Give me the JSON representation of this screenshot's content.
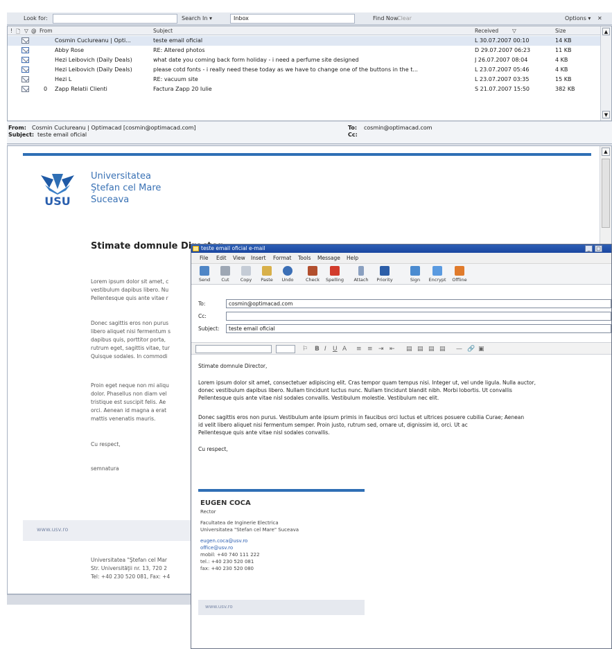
{
  "findbar": {
    "look_for_label": "Look for:",
    "search_in_label": "Search In ▾",
    "search_in_value": "Inbox",
    "find_now": "Find Now",
    "clear": "Clear",
    "options": "Options ▾",
    "close": "✕"
  },
  "list": {
    "headers": {
      "importance": "!",
      "icon": "🗋",
      "flag": "▽",
      "attach": "@",
      "from": "From",
      "subject": "Subject",
      "received": "Received",
      "sort": "▽",
      "size": "Size"
    },
    "rows": [
      {
        "from": "Cosmin Cuclureanu | Opti...",
        "subject": "teste email oficial",
        "received": "L 30.07.2007 00:10",
        "size": "14 KB",
        "attach": ""
      },
      {
        "from": "Abby Rose",
        "subject": "RE: Altered photos",
        "received": "D 29.07.2007 06:23",
        "size": "11 KB",
        "attach": ""
      },
      {
        "from": "Hezi Leibovich (Daily Deals)",
        "subject": "what date you coming back form holiday - i need a perfume site designed",
        "received": "J 26.07.2007 08:04",
        "size": "4 KB",
        "attach": ""
      },
      {
        "from": "Hezi Leibovich (Daily Deals)",
        "subject": "please cotd fonts - i really need these today as we have to change one of the buttons in the t...",
        "received": "L 23.07.2007 05:46",
        "size": "4 KB",
        "attach": ""
      },
      {
        "from": "Hezi L",
        "subject": "RE: vacuum site",
        "received": "L 23.07.2007 03:35",
        "size": "15 KB",
        "attach": ""
      },
      {
        "from": "Zapp Relatii Clienti",
        "subject": "Factura Zapp 20 Iulie",
        "received": "S 21.07.2007 15:50",
        "size": "382 KB",
        "attach": "0"
      }
    ]
  },
  "reading": {
    "from_label": "From:",
    "from_value": "Cosmin Cuclureanu | Optimacad [cosmin@optimacad.com]",
    "to_label": "To:",
    "to_value": "cosmin@optimacad.com",
    "subject_label": "Subject:",
    "subject_value": "teste email oficial",
    "cc_label": "Cc:",
    "uni_line1": "Universitatea",
    "uni_line2": "Ştefan cel Mare",
    "uni_line3": "Suceava",
    "logo_text": "USU",
    "greeting": "Stimate domnule Director,",
    "p1": "Lorem ipsum dolor sit amet, c\nvestibulum dapibus libero. Nu\nPellentesque quis ante vitae r",
    "p2": "Donec sagittis eros non purus\nlibero aliquet nisi fermentum s\ndapibus quis, porttitor porta, \nrutrum eget, sagittis vitae, tur\nQuisque sodales. In commodi",
    "p3": "Proin eget neque non mi aliqu\ndolor. Phasellus non diam vel\ntristique est suscipit felis. Ae\norci. Aenean id magna a erat\nmattis venenatis mauris.",
    "closing": "Cu respect,",
    "signature": "semnatura",
    "website": "www.usv.ro",
    "address": "Universitatea \"Ştefan cel Mar\nStr. Universităţii nr. 13, 720 2\nTel: +40 230 520 081, Fax: +4"
  },
  "compose": {
    "title": "teste email oficial e-mail",
    "menu": [
      "File",
      "Edit",
      "View",
      "Insert",
      "Format",
      "Tools",
      "Message",
      "Help"
    ],
    "toolbar": [
      "Send",
      "Cut",
      "Copy",
      "Paste",
      "Undo",
      "Check",
      "Spelling",
      "Attach",
      "Priority",
      "Sign",
      "Encrypt",
      "Offline"
    ],
    "to_label": "To:",
    "to_value": "cosmin@optimacad.com",
    "cc_label": "Cc:",
    "cc_value": "",
    "subject_label": "Subject:",
    "subject_value": "teste email oficial",
    "font_select": "",
    "size_select": "",
    "body_greeting": "Stimate domnule Director,",
    "body_p1": "Lorem ipsum dolor sit amet, consectetuer adipiscing elit. Cras tempor quam tempus nisi. Integer ut, vel unde ligula. Nulla auctor,\ndonec vestibulum dapibus libero. Nullam tincidunt luctus nunc. Nullam tincidunt blandit nibh. Morbi lobortis. Ut convallis\nPellentesque quis ante vitae nisl sodales convallis. Vestibulum molestie. Vestibulum nec elit.",
    "body_p2": "Donec sagittis eros non purus. Vestibulum ante ipsum primis in faucibus orci luctus et ultrices posuere cubilia Curae; Aenean\nid velit libero aliquet nisi fermentum semper. Proin justo, rutrum sed, ornare ut, dignissim id, orci. Ut ac\nPellentesque quis ante vitae nisl sodales convallis.",
    "body_closing": "Cu respect,",
    "sig_name": "EUGEN COCA",
    "sig_role": "Rector",
    "sig_org1": "Facultatea de Inginerie Electrica",
    "sig_org2": "Universitatea \"Stefan cel Mare\" Suceava",
    "sig_email1": "eugen.coca@usv.ro",
    "sig_email2": "office@usv.ro",
    "sig_phone1": "mobil: +40 740 111 222",
    "sig_phone2": "tel.: +40 230 520 081",
    "sig_phone3": "fax: +40 230 520 080",
    "sig_web": "www.usv.ro"
  }
}
